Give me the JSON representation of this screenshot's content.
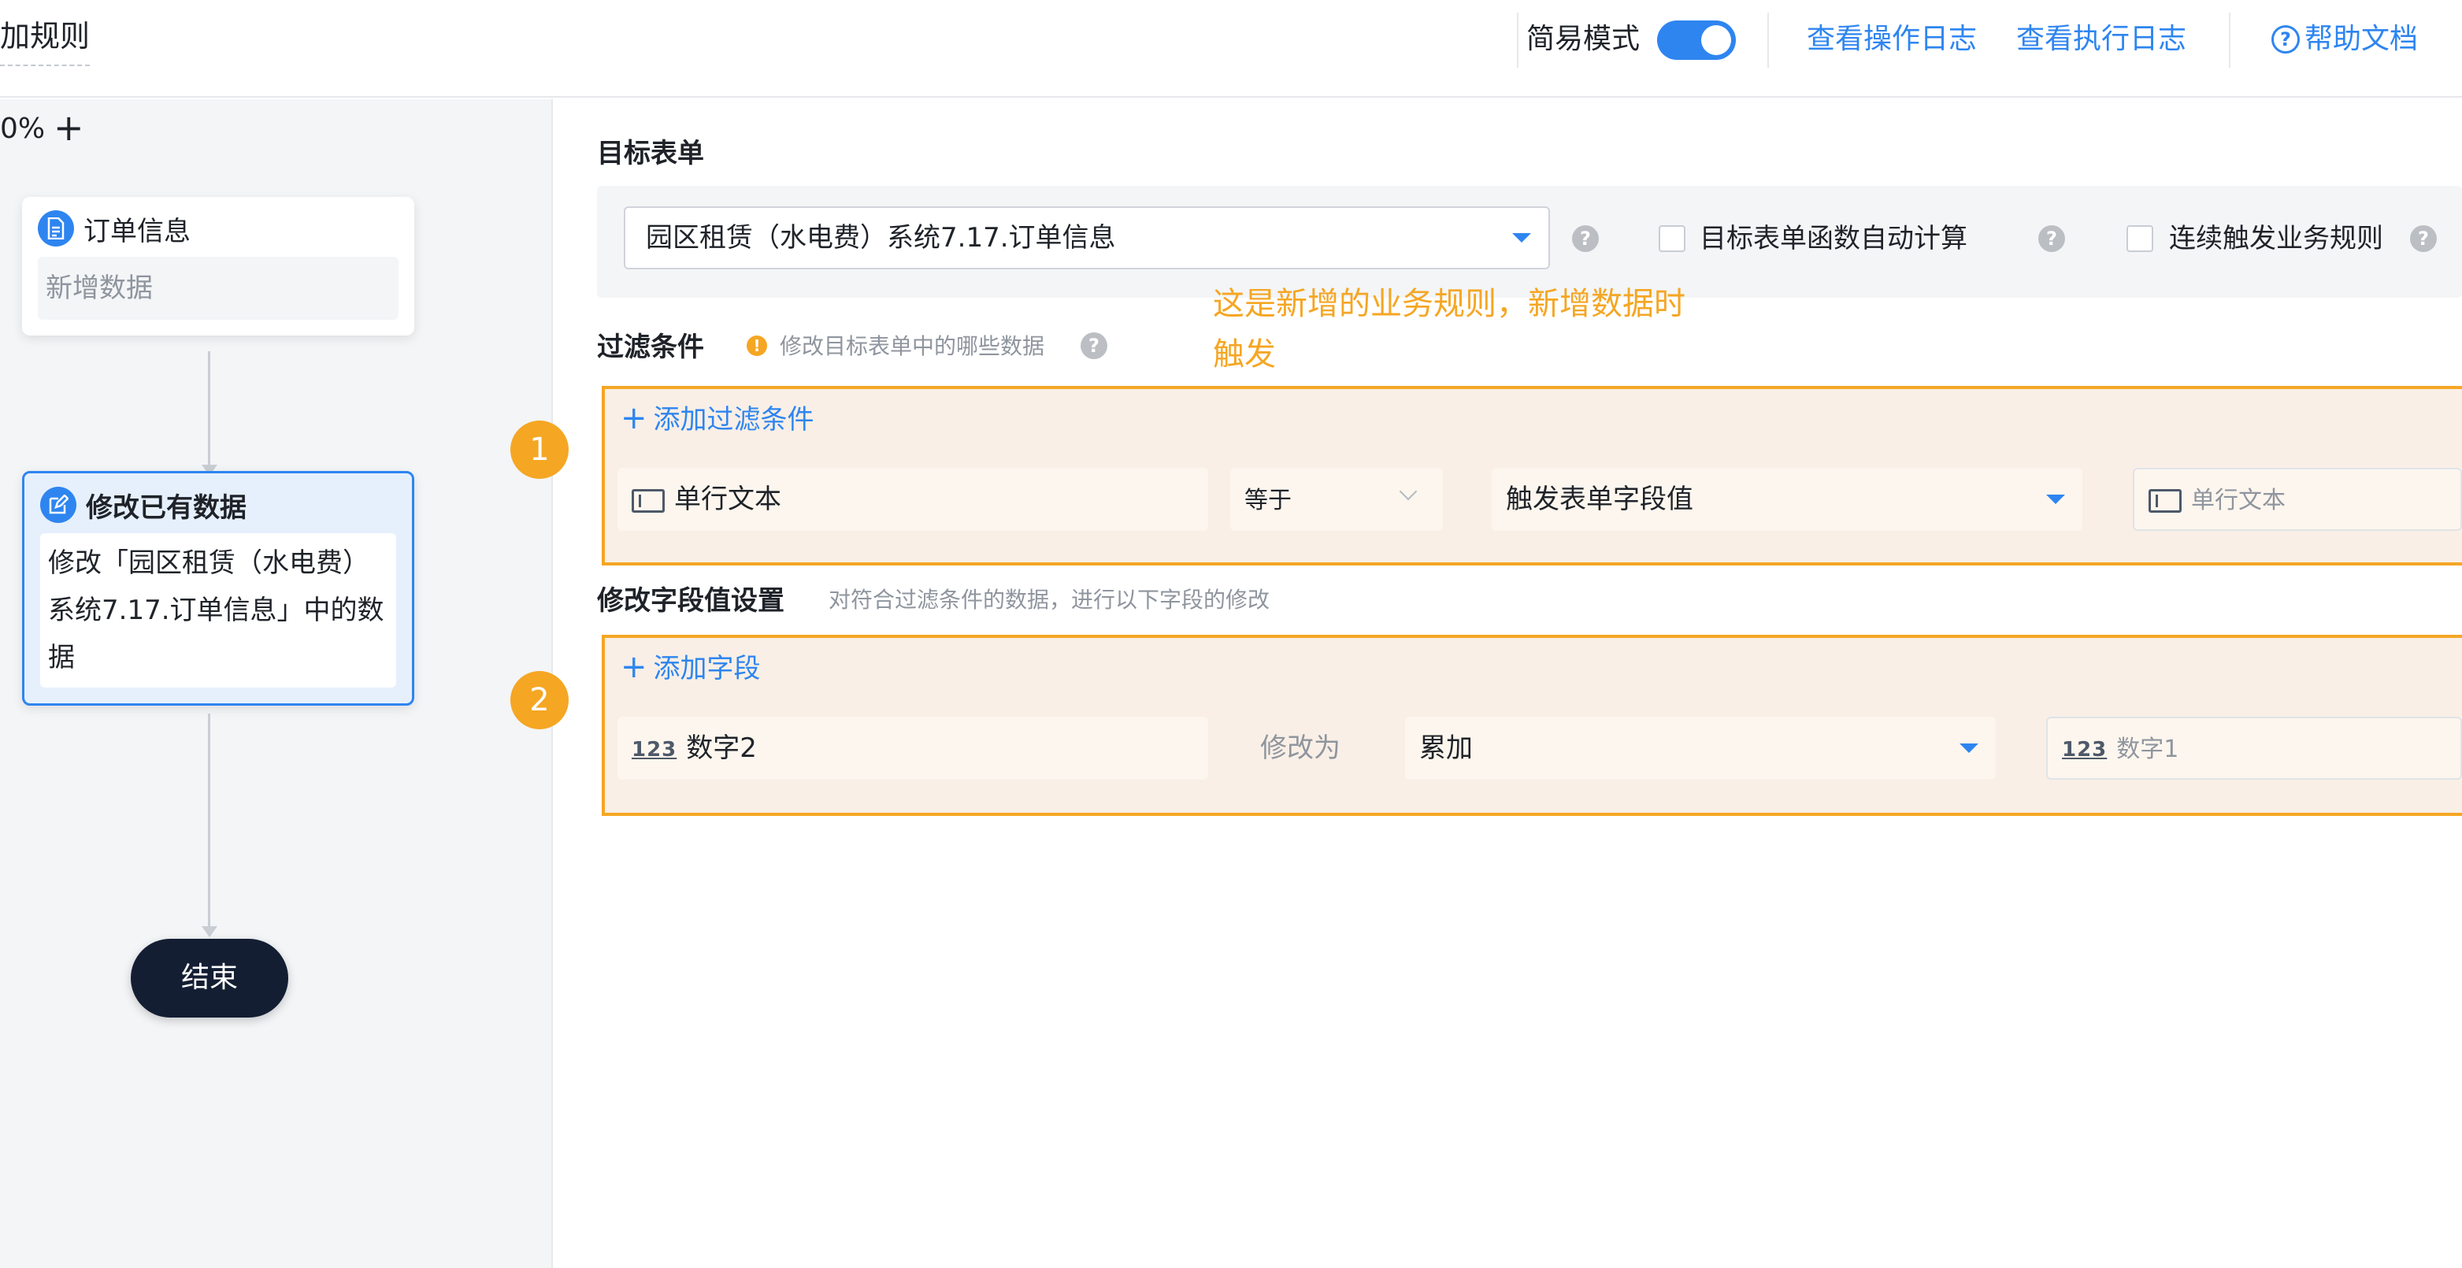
{
  "header": {
    "title": "加规则",
    "simple_mode_label": "简易模式",
    "simple_mode_on": true,
    "links": {
      "op_log": "查看操作日志",
      "exec_log": "查看执行日志",
      "help": "帮助文档"
    },
    "help_icon_glyph": "?"
  },
  "flow": {
    "zoom": "0%",
    "zoom_in": "+",
    "trigger_node": {
      "title": "订单信息",
      "action": "新增数据",
      "icon": "document-icon"
    },
    "modify_node": {
      "title": "修改已有数据",
      "description": "修改「园区租赁（水电费）系统7.17.订单信息」中的数据",
      "icon": "edit-icon",
      "selected": true
    },
    "end_node": {
      "label": "结束"
    }
  },
  "config": {
    "target_form": {
      "title": "目标表单",
      "selected_form": "园区租赁（水电费）系统7.17.订单信息",
      "auto_calc_label": "目标表单函数自动计算",
      "auto_calc_checked": false,
      "chain_trigger_label": "连续触发业务规则",
      "chain_trigger_checked": false,
      "help_glyph": "?"
    },
    "annotation": "这是新增的业务规则，新增数据时触发",
    "filter": {
      "title": "过滤条件",
      "warn_glyph": "!",
      "hint": "修改目标表单中的哪些数据",
      "badge": "1",
      "add_label": "添加过滤条件",
      "row": {
        "field": "单行文本",
        "operator": "等于",
        "value_type": "触发表单字段值",
        "value_field": "单行文本"
      }
    },
    "modify_fields": {
      "title": "修改字段值设置",
      "hint": "对符合过滤条件的数据，进行以下字段的修改",
      "badge": "2",
      "add_label": "添加字段",
      "row": {
        "field_icon_text": "123",
        "field": "数字2",
        "modify_as": "修改为",
        "method": "累加",
        "value_icon_text": "123",
        "value_field": "数字1"
      }
    }
  },
  "colors": {
    "accent": "#2e85f0",
    "highlight": "#f5a623",
    "end_node": "#141e33"
  }
}
